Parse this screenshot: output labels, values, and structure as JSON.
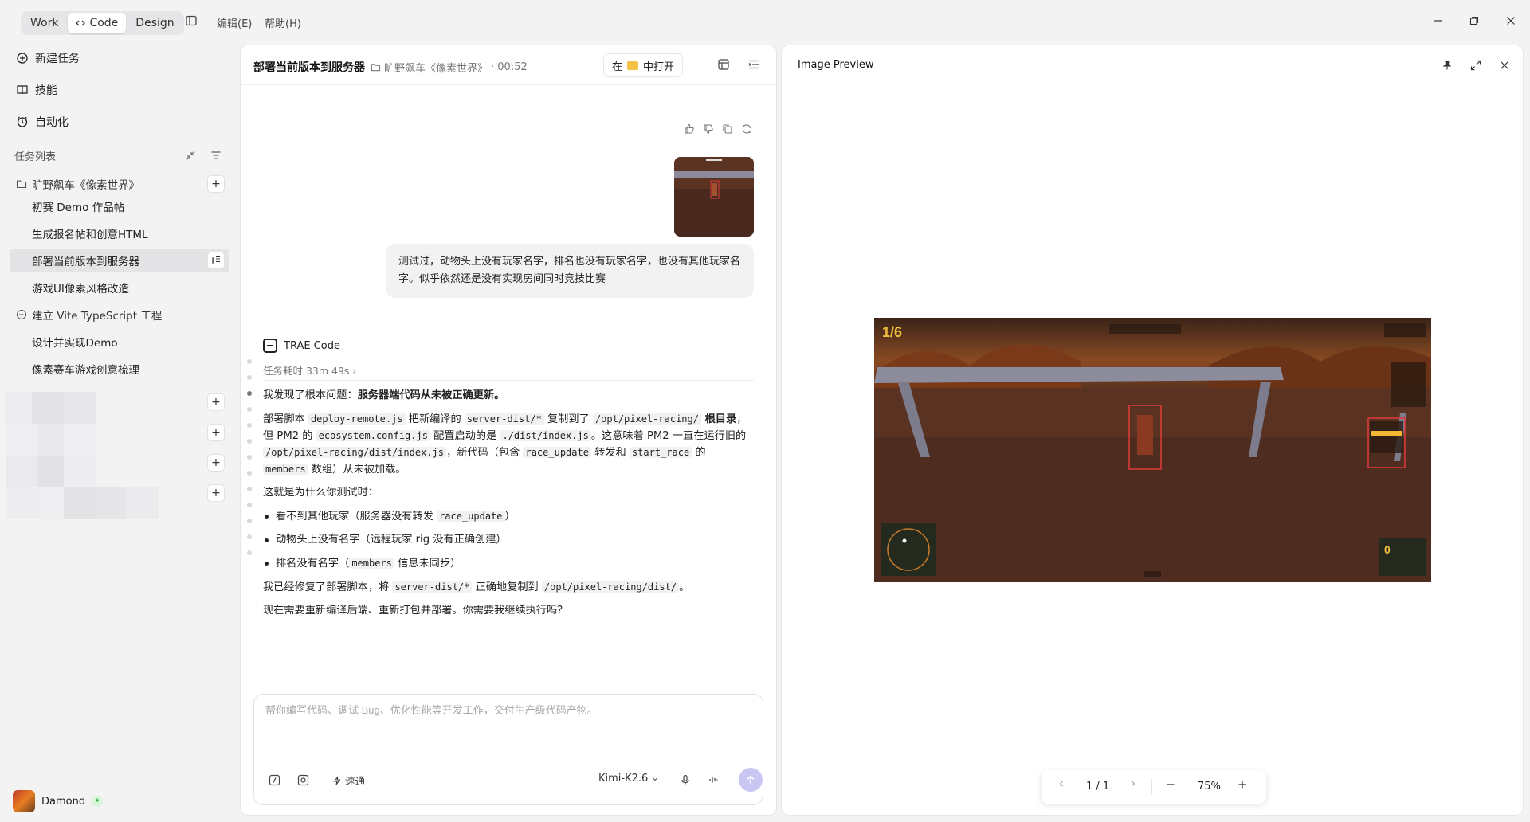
{
  "titlebar": {
    "modes": [
      "Work",
      "Code",
      "Design"
    ],
    "active_mode": "Code",
    "menus": [
      "编辑(E)",
      "帮助(H)"
    ]
  },
  "sidebar": {
    "nav": [
      {
        "label": "新建任务",
        "icon": "new-task-icon"
      },
      {
        "label": "技能",
        "icon": "book-icon"
      },
      {
        "label": "自动化",
        "icon": "clock-icon"
      }
    ],
    "task_list_title": "任务列表",
    "groups": [
      {
        "label": "旷野飙车《像素世界》",
        "children": [
          "初赛 Demo 作品帖",
          "生成报名帖和创意HTML",
          "部署当前版本到服务器",
          "游戏UI像素风格改造"
        ]
      },
      {
        "label": "建立 Vite TypeScript 工程",
        "children": [
          "设计并实现Demo",
          "像素赛车游戏创意梳理"
        ]
      }
    ],
    "selected_task": "部署当前版本到服务器",
    "user_name": "Damond"
  },
  "chat": {
    "title": "部署当前版本到服务器",
    "project": "旷野飙车《像素世界》",
    "time": "· 00:52",
    "open_in_prefix": "在",
    "open_in_suffix": "中打开",
    "user_message": "测试过，动物头上没有玩家名字，排名也没有玩家名字，也没有其他玩家名字。似乎依然还是没有实现房间同时竞技比赛",
    "agent_name": "TRAE Code",
    "elapsed": "任务耗时 33m 49s ›",
    "answer": {
      "p1_prefix": "我发现了根本问题：",
      "p1_bold": "服务器端代码从未被正确更新。",
      "p2_a": "部署脚本 ",
      "p2_code1": "deploy-remote.js",
      "p2_b": " 把新编译的 ",
      "p2_code2": "server-dist/*",
      "p2_c": " 复制到了 ",
      "p2_code3": "/opt/pixel-racing/",
      "p2_bold": " 根目录",
      "p2_d": "，但 PM2 的 ",
      "p2_code4": "ecosystem.config.js",
      "p2_e": " 配置启动的是 ",
      "p2_code5": "./dist/index.js",
      "p2_f": "。这意味着 PM2 一直在运行旧的 ",
      "p2_code6": "/opt/pixel-racing/dist/index.js",
      "p2_g": "，新代码（包含 ",
      "p2_code7": "race_update",
      "p2_h": " 转发和 ",
      "p2_code8": "start_race",
      "p2_i": " 的 ",
      "p2_code9": "members",
      "p2_j": " 数组）从未被加载。",
      "p3": "这就是为什么你测试时：",
      "li1_a": "看不到其他玩家（服务器没有转发 ",
      "li1_code": "race_update",
      "li1_b": "）",
      "li2": "动物头上没有名字（远程玩家 rig 没有正确创建）",
      "li3_a": "排名没有名字（",
      "li3_code": "members",
      "li3_b": " 信息未同步）",
      "p4_a": "我已经修复了部署脚本，将 ",
      "p4_code1": "server-dist/*",
      "p4_b": " 正确地复制到 ",
      "p4_code2": "/opt/pixel-racing/dist/",
      "p4_c": "。",
      "p5": "现在需要重新编译后端、重新打包并部署。你需要我继续执行吗？"
    },
    "composer_placeholder": "帮你编写代码、调试 Bug、优化性能等开发工作，交付生产级代码产物。",
    "speed_label": "速通",
    "model": "Kimi-K2.6"
  },
  "preview": {
    "title": "Image Preview",
    "page": "1 / 1",
    "zoom": "75%"
  },
  "colors": {
    "accent": "#c9c6f2",
    "selected_row": "#e4e4e7",
    "highlight_box": "#e03a3a"
  }
}
